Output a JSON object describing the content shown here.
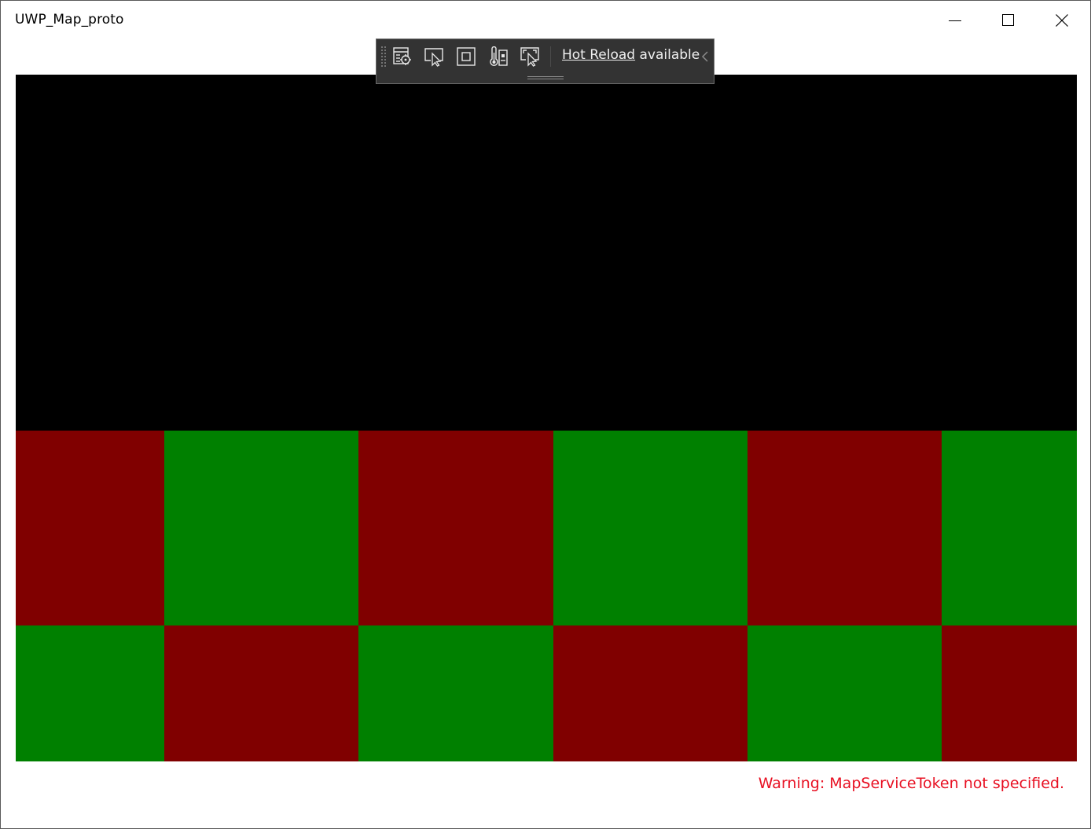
{
  "window": {
    "title": "UWP_Map_proto",
    "caption_buttons": {
      "minimize": "minimize-icon",
      "maximize": "maximize-icon",
      "close": "close-icon"
    }
  },
  "dev_toolbar": {
    "tools": [
      {
        "icon": "live-visual-tree-icon"
      },
      {
        "icon": "select-element-icon"
      },
      {
        "icon": "display-layout-adorners-icon"
      },
      {
        "icon": "track-focus-icon"
      },
      {
        "icon": "binding-failures-icon"
      }
    ],
    "hot_reload_link": "Hot Reload",
    "hot_reload_suffix": " available",
    "collapse_icon": "chevron-left-icon"
  },
  "map": {
    "colors": {
      "background": "#000000",
      "tile_red": "#800000",
      "tile_green": "#008000"
    },
    "tile_pattern": [
      [
        "red",
        "green",
        "red",
        "green",
        "red",
        "green"
      ],
      [
        "green",
        "red",
        "green",
        "red",
        "green",
        "red"
      ]
    ]
  },
  "status": {
    "warning": "Warning: MapServiceToken not specified.",
    "warning_color": "#e81123"
  }
}
